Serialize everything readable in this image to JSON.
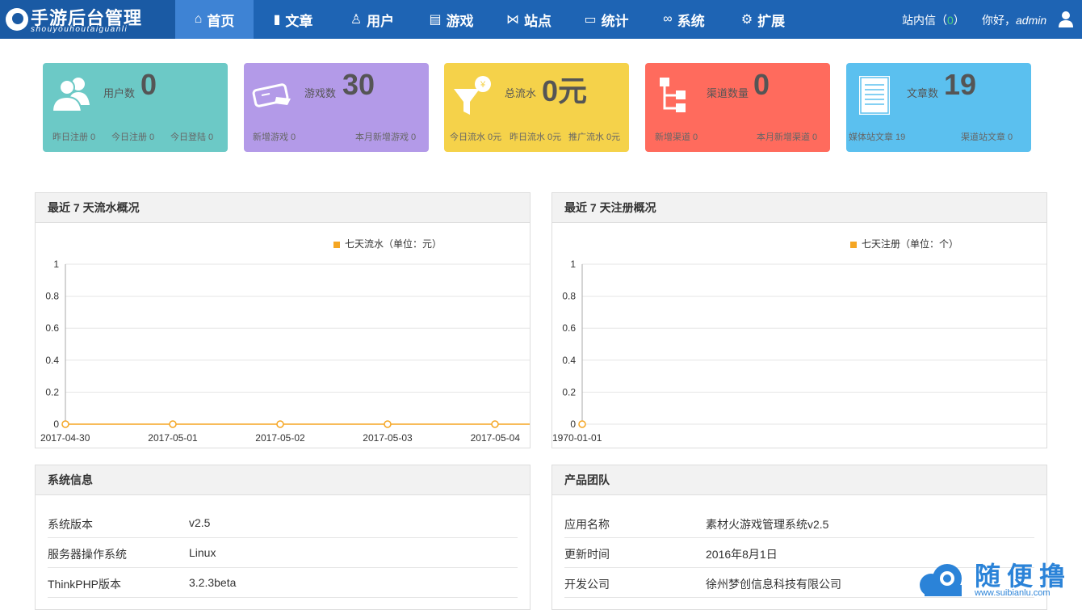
{
  "app": {
    "logo_title": "手游后台管理",
    "logo_subtitle": "shouyouhoutaiguanli"
  },
  "nav": [
    {
      "label": "首页",
      "icon": "home-icon",
      "glyph": "⌂"
    },
    {
      "label": "文章",
      "icon": "bar-chart-icon",
      "glyph": "▮"
    },
    {
      "label": "用户",
      "icon": "user-icon",
      "glyph": "♙"
    },
    {
      "label": "游戏",
      "icon": "document-icon",
      "glyph": "▤"
    },
    {
      "label": "站点",
      "icon": "share-icon",
      "glyph": "⋈"
    },
    {
      "label": "统计",
      "icon": "monitor-icon",
      "glyph": "▭"
    },
    {
      "label": "系统",
      "icon": "link-icon",
      "glyph": "∞"
    },
    {
      "label": "扩展",
      "icon": "gear-icon",
      "glyph": "⚙"
    }
  ],
  "header": {
    "msg_prefix": "站内信（",
    "msg_count": "0",
    "msg_suffix": "）",
    "greeting": "你好，",
    "username": "admin"
  },
  "stats": [
    {
      "label": "用户数",
      "value": "0",
      "color": "#6cc9c6",
      "icon": "users-icon",
      "subs": [
        "昨日注册 0",
        "今日注册 0",
        "今日登陆 0"
      ]
    },
    {
      "label": "游戏数",
      "value": "30",
      "color": "#b39ae8",
      "icon": "gamepad-icon",
      "subs": [
        "新增游戏 0",
        "本月新增游戏 0"
      ]
    },
    {
      "label": "总流水",
      "value": "0元",
      "color": "#f5d24a",
      "icon": "funnel-yen-icon",
      "subs": [
        "今日流水 0元",
        "昨日流水 0元",
        "推广流水 0元"
      ]
    },
    {
      "label": "渠道数量",
      "value": "0",
      "color": "#ff6b5d",
      "icon": "sitemap-icon",
      "subs": [
        "新增渠道 0",
        "本月新增渠道 0"
      ]
    },
    {
      "label": "文章数",
      "value": "19",
      "color": "#5bc0ef",
      "icon": "article-icon",
      "subs": [
        "媒体站文章 19",
        "渠道站文章 0"
      ]
    }
  ],
  "panels": {
    "revenue": {
      "title": "最近 7 天流水概况"
    },
    "register": {
      "title": "最近 7 天注册概况"
    },
    "sysinfo": {
      "title": "系统信息",
      "rows": [
        {
          "k": "系统版本",
          "v": "v2.5"
        },
        {
          "k": "服务器操作系统",
          "v": "Linux"
        },
        {
          "k": "ThinkPHP版本",
          "v": "3.2.3beta"
        }
      ]
    },
    "team": {
      "title": "产品团队",
      "rows": [
        {
          "k": "应用名称",
          "v": "素材火游戏管理系统v2.5"
        },
        {
          "k": "更新时间",
          "v": "2016年8月1日"
        },
        {
          "k": "开发公司",
          "v": "徐州梦创信息科技有限公司"
        }
      ]
    }
  },
  "chart_data": [
    {
      "type": "line",
      "title": "",
      "x": [
        "2017-04-30",
        "2017-05-01",
        "2017-05-02",
        "2017-05-03",
        "2017-05-04"
      ],
      "series": [
        {
          "name": "七天流水（单位：元）",
          "values": [
            0,
            0,
            0,
            0,
            0
          ],
          "color": "#f5a623"
        }
      ],
      "yticks": [
        "0",
        "0.2",
        "0.4",
        "0.6",
        "0.8",
        "1"
      ],
      "ylim": [
        0,
        1
      ],
      "grid": true,
      "legend": "top-right"
    },
    {
      "type": "line",
      "title": "",
      "x": [
        "1970-01-01"
      ],
      "series": [
        {
          "name": "七天注册（单位：个）",
          "values": [
            0
          ],
          "color": "#f5a623"
        }
      ],
      "yticks": [
        "0",
        "0.2",
        "0.4",
        "0.6",
        "0.8",
        "1"
      ],
      "ylim": [
        0,
        1
      ],
      "grid": true,
      "legend": "top-right"
    }
  ],
  "watermark": {
    "text": "随便撸",
    "url": "www.suibianlu.com"
  }
}
